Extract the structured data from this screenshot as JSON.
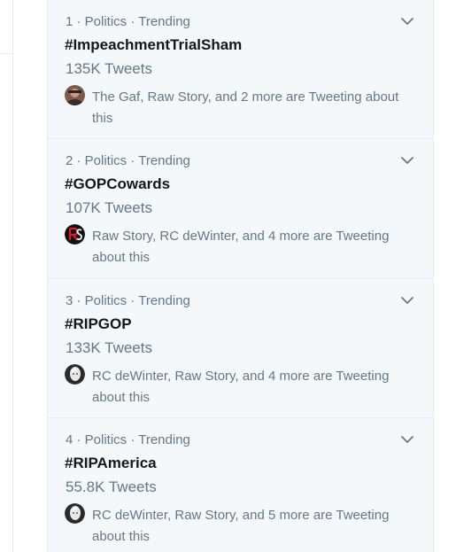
{
  "trends": [
    {
      "rank": "1",
      "meta": "1 · Politics · Trending",
      "hashtag": "#ImpeachmentTrialSham",
      "count": "135K Tweets",
      "context": "The Gaf, Raw Story, and 2 more are Tweeting about this",
      "avatar_icon": "user-avatar-photo"
    },
    {
      "rank": "2",
      "meta": "2 · Politics · Trending",
      "hashtag": "#GOPCowards",
      "count": "107K Tweets",
      "context": "Raw Story, RC deWinter, and 4 more are Tweeting about this",
      "avatar_icon": "raw-story-logo-avatar"
    },
    {
      "rank": "3",
      "meta": "3 · Politics · Trending",
      "hashtag": "#RIPGOP",
      "count": "133K Tweets",
      "context": "RC deWinter, Raw Story, and 4 more are Tweeting about this",
      "avatar_icon": "user-avatar-photo"
    },
    {
      "rank": "4",
      "meta": "4 · Politics · Trending",
      "hashtag": "#RIPAmerica",
      "count": "55.8K Tweets",
      "context": "RC deWinter, Raw Story, and 5 more are Tweeting about this",
      "avatar_icon": "user-avatar-photo"
    }
  ],
  "colors": {
    "panel_background": "#f5f8fa",
    "secondary_text": "#657786",
    "primary_text": "#14171a",
    "divider": "#e6ecf0"
  }
}
